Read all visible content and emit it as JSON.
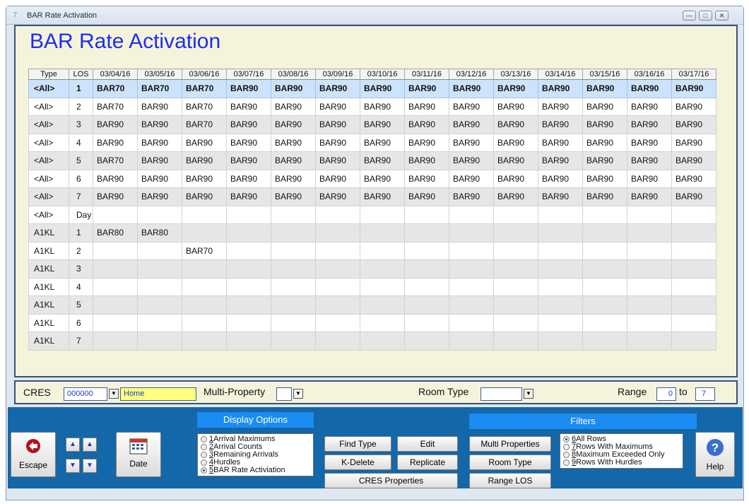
{
  "window": {
    "title": "BAR Rate Activation",
    "icon": "app-icon",
    "controls": [
      "minimize",
      "maximize",
      "close"
    ]
  },
  "heading": "BAR Rate Activation",
  "grid": {
    "headers": [
      "Type",
      "LOS",
      "03/04/16",
      "03/05/16",
      "03/06/16",
      "03/07/16",
      "03/08/16",
      "03/09/16",
      "03/10/16",
      "03/11/16",
      "03/12/16",
      "03/13/16",
      "03/14/16",
      "03/15/16",
      "03/16/16",
      "03/17/16"
    ],
    "rows": [
      [
        "<All>",
        "1",
        "BAR70",
        "BAR70",
        "BAR70",
        "BAR90",
        "BAR90",
        "BAR90",
        "BAR90",
        "BAR90",
        "BAR90",
        "BAR90",
        "BAR90",
        "BAR90",
        "BAR90",
        "BAR90"
      ],
      [
        "<All>",
        "2",
        "BAR70",
        "BAR90",
        "BAR70",
        "BAR90",
        "BAR90",
        "BAR90",
        "BAR90",
        "BAR90",
        "BAR90",
        "BAR90",
        "BAR90",
        "BAR90",
        "BAR90",
        "BAR90"
      ],
      [
        "<All>",
        "3",
        "BAR90",
        "BAR90",
        "BAR70",
        "BAR90",
        "BAR90",
        "BAR90",
        "BAR90",
        "BAR90",
        "BAR90",
        "BAR90",
        "BAR90",
        "BAR90",
        "BAR90",
        "BAR90"
      ],
      [
        "<All>",
        "4",
        "BAR90",
        "BAR90",
        "BAR90",
        "BAR90",
        "BAR90",
        "BAR90",
        "BAR90",
        "BAR90",
        "BAR90",
        "BAR90",
        "BAR90",
        "BAR90",
        "BAR90",
        "BAR90"
      ],
      [
        "<All>",
        "5",
        "BAR70",
        "BAR90",
        "BAR90",
        "BAR90",
        "BAR90",
        "BAR90",
        "BAR90",
        "BAR90",
        "BAR90",
        "BAR90",
        "BAR90",
        "BAR90",
        "BAR90",
        "BAR90"
      ],
      [
        "<All>",
        "6",
        "BAR90",
        "BAR90",
        "BAR90",
        "BAR90",
        "BAR90",
        "BAR90",
        "BAR90",
        "BAR90",
        "BAR90",
        "BAR90",
        "BAR90",
        "BAR90",
        "BAR90",
        "BAR90"
      ],
      [
        "<All>",
        "7",
        "BAR90",
        "BAR90",
        "BAR90",
        "BAR90",
        "BAR90",
        "BAR90",
        "BAR90",
        "BAR90",
        "BAR90",
        "BAR90",
        "BAR90",
        "BAR90",
        "BAR90",
        "BAR90"
      ],
      [
        "<All>",
        "Day",
        "",
        "",
        "",
        "",
        "",
        "",
        "",
        "",
        "",
        "",
        "",
        "",
        "",
        ""
      ],
      [
        "A1KL",
        "1",
        "BAR80",
        "BAR80",
        "",
        "",
        "",
        "",
        "",
        "",
        "",
        "",
        "",
        "",
        "",
        ""
      ],
      [
        "A1KL",
        "2",
        "",
        "",
        "BAR70",
        "",
        "",
        "",
        "",
        "",
        "",
        "",
        "",
        "",
        "",
        ""
      ],
      [
        "A1KL",
        "3",
        "",
        "",
        "",
        "",
        "",
        "",
        "",
        "",
        "",
        "",
        "",
        "",
        "",
        ""
      ],
      [
        "A1KL",
        "4",
        "",
        "",
        "",
        "",
        "",
        "",
        "",
        "",
        "",
        "",
        "",
        "",
        "",
        ""
      ],
      [
        "A1KL",
        "5",
        "",
        "",
        "",
        "",
        "",
        "",
        "",
        "",
        "",
        "",
        "",
        "",
        "",
        ""
      ],
      [
        "A1KL",
        "6",
        "",
        "",
        "",
        "",
        "",
        "",
        "",
        "",
        "",
        "",
        "",
        "",
        "",
        ""
      ],
      [
        "A1KL",
        "7",
        "",
        "",
        "",
        "",
        "",
        "",
        "",
        "",
        "",
        "",
        "",
        "",
        "",
        ""
      ]
    ]
  },
  "filter_bar": {
    "cres_label": "CRES",
    "cres_value": "000000",
    "cres_name": "Home",
    "multi_property_label": "Multi-Property",
    "room_type_label": "Room Type",
    "range_label": "Range",
    "range_from": "0",
    "range_to_label": "to",
    "range_to": "7"
  },
  "toolbar": {
    "escape": "Escape",
    "date": "Date",
    "display_options_title": "Display Options",
    "display_options": [
      {
        "num": "1",
        "label": "Arrival Maximums",
        "selected": false
      },
      {
        "num": "2",
        "label": "Arrival Counts",
        "selected": false
      },
      {
        "num": "3",
        "label": "Remaining Arrivals",
        "selected": false
      },
      {
        "num": "4",
        "label": "Hurdles",
        "selected": false
      },
      {
        "num": "5",
        "label": "BAR Rate Activiation",
        "selected": true
      }
    ],
    "find_type": "Find Type",
    "edit": "Edit",
    "k_delete": "K-Delete",
    "replicate": "Replicate",
    "cres_properties": "CRES Properties",
    "multi_properties": "Multi Properties",
    "room_type": "Room Type",
    "range_los": "Range LOS",
    "filters_title": "Filters",
    "filters": [
      {
        "num": "6",
        "label": "All Rows",
        "selected": true
      },
      {
        "num": "7",
        "label": "Rows With Maximums",
        "selected": false
      },
      {
        "num": "8",
        "label": "Maximum Exceeded Only",
        "selected": false
      },
      {
        "num": "9",
        "label": "Rows With Hurdles",
        "selected": false
      }
    ],
    "help": "Help"
  }
}
